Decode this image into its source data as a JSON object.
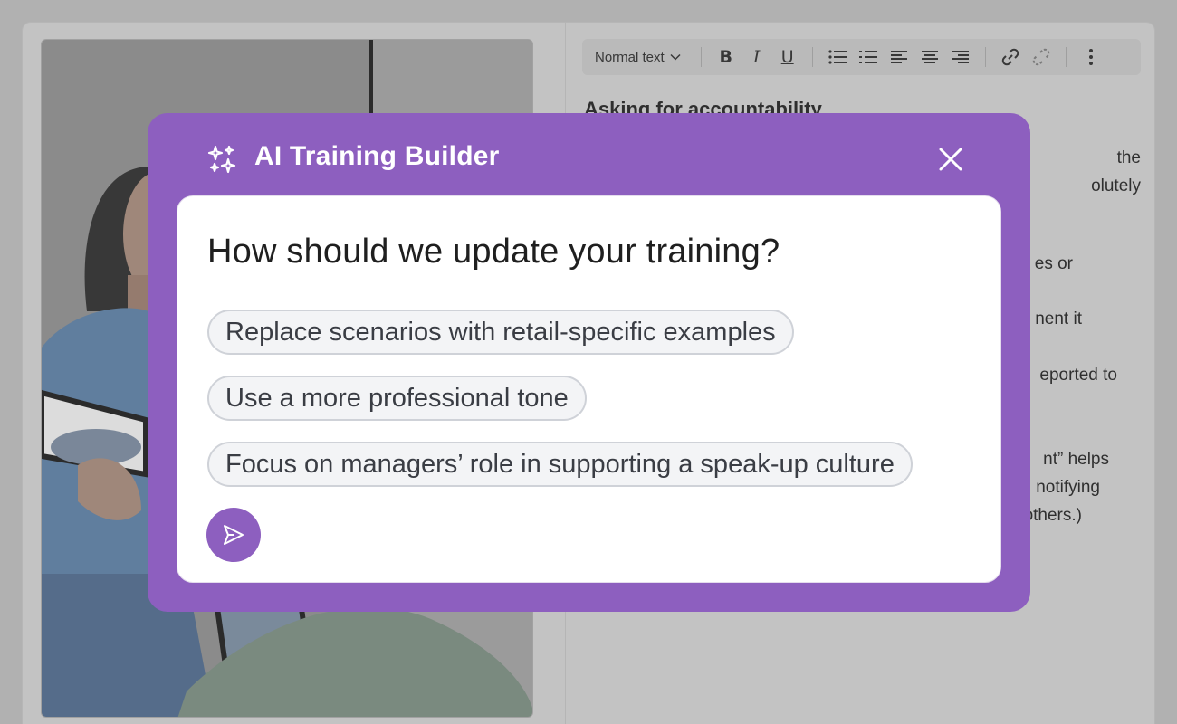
{
  "editor": {
    "toolbar": {
      "style_select": "Normal text",
      "bold": "B",
      "italic": "I",
      "underline": "U"
    },
    "heading": "Asking for accountability",
    "text_fragments": [
      "the",
      "olutely",
      "es or",
      "nent it",
      "eported to",
      "nt” helps",
      "notifying",
      "others.)"
    ]
  },
  "modal": {
    "title": "AI Training Builder",
    "question": "How should we update your training?",
    "suggestions": [
      "Replace scenarios with retail-specific examples",
      "Use a more professional tone",
      "Focus on managers’ role in supporting a speak-up culture"
    ],
    "icons": {
      "header": "sparkle-icon",
      "close": "close-icon",
      "send": "send-icon"
    }
  },
  "colors": {
    "accent": "#8d5fbf",
    "card": "#ffffff",
    "chip_bg": "#f3f4f6",
    "chip_border": "#cfd2d8"
  }
}
